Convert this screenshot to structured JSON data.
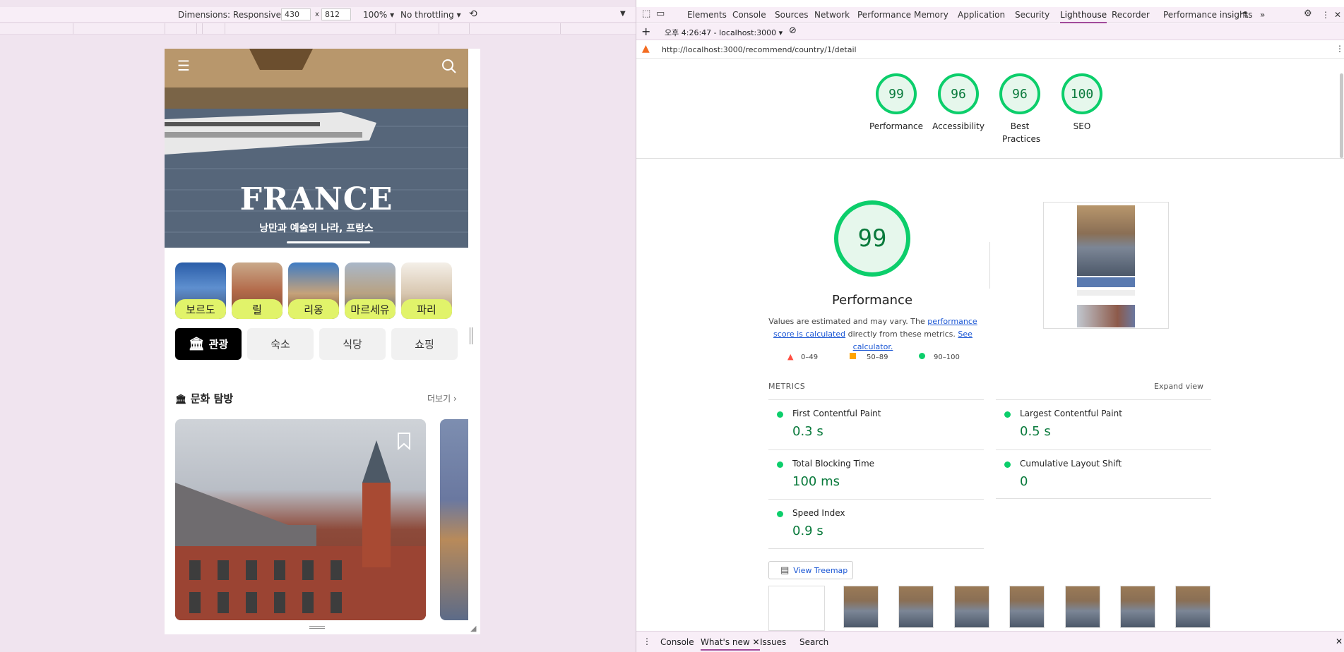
{
  "device_toolbar": {
    "dimensions_label": "Dimensions: Responsive",
    "width": "430",
    "times": "x",
    "height": "812",
    "zoom": "100%",
    "throttling": "No throttling"
  },
  "app": {
    "hero_title": "FRANCE",
    "hero_subtitle": "낭만과 예술의 나라, 프랑스",
    "cities": [
      {
        "label": "보르도"
      },
      {
        "label": "릴"
      },
      {
        "label": "리옹"
      },
      {
        "label": "마르세유"
      },
      {
        "label": "파리"
      }
    ],
    "categories": [
      {
        "label": "관광",
        "active": true
      },
      {
        "label": "숙소",
        "active": false
      },
      {
        "label": "식당",
        "active": false
      },
      {
        "label": "쇼핑",
        "active": false
      }
    ],
    "section_title": "문화 탐방",
    "more_label": "더보기"
  },
  "devtools": {
    "tabs": [
      "Elements",
      "Console",
      "Sources",
      "Network",
      "Performance",
      "Memory",
      "Application",
      "Security",
      "Lighthouse",
      "Recorder",
      "Performance insights"
    ],
    "active_tab": "Lighthouse",
    "report_time": "오후 4:26:47 - localhost:3000",
    "url": "http://localhost:3000/recommend/country/1/detail",
    "scores": [
      {
        "value": "99",
        "label": "Performance"
      },
      {
        "value": "96",
        "label": "Accessibility"
      },
      {
        "value": "96",
        "label": "Best Practices"
      },
      {
        "value": "100",
        "label": "SEO"
      }
    ],
    "main_score": "99",
    "main_label": "Performance",
    "note_prefix": "Values are estimated and may vary. The",
    "note_link1": "performance score is calculated",
    "note_mid": "directly from these metrics.",
    "note_link2": "See calculator.",
    "legend": [
      {
        "range": "0–49",
        "color": "#ff4e42"
      },
      {
        "range": "50–89",
        "color": "#ffa400"
      },
      {
        "range": "90–100",
        "color": "#0cce6b"
      }
    ],
    "metrics_heading": "METRICS",
    "expand_view": "Expand view",
    "metrics": [
      {
        "name": "First Contentful Paint",
        "value": "0.3 s"
      },
      {
        "name": "Largest Contentful Paint",
        "value": "0.5 s"
      },
      {
        "name": "Total Blocking Time",
        "value": "100 ms"
      },
      {
        "name": "Cumulative Layout Shift",
        "value": "0"
      },
      {
        "name": "Speed Index",
        "value": "0.9 s"
      }
    ],
    "treemap_button": "View Treemap",
    "drawer_tabs": [
      "Console",
      "What's new",
      "Issues",
      "Search"
    ],
    "drawer_active": "What's new"
  }
}
